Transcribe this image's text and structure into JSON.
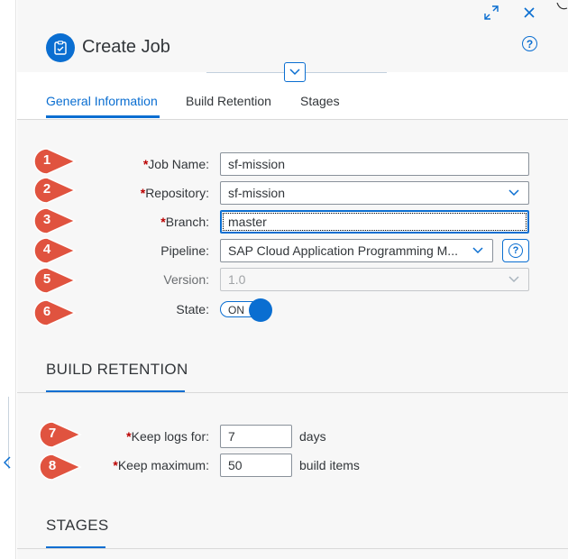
{
  "dialog": {
    "title": "Create Job"
  },
  "tabs": [
    {
      "label": "General Information",
      "active": true
    },
    {
      "label": "Build Retention",
      "active": false
    },
    {
      "label": "Stages",
      "active": false
    }
  ],
  "form": {
    "required_mark": "*",
    "job_name": {
      "label": "Job Name:",
      "value": "sf-mission"
    },
    "repository": {
      "label": "Repository:",
      "value": "sf-mission"
    },
    "branch": {
      "label": "Branch:",
      "value": "master"
    },
    "pipeline": {
      "label": "Pipeline:",
      "value": "SAP Cloud Application Programming M...",
      "help": "?"
    },
    "version": {
      "label": "Version:",
      "value": "1.0"
    },
    "state": {
      "label": "State:",
      "value": "ON"
    }
  },
  "build_retention": {
    "heading": "BUILD RETENTION",
    "keep_logs": {
      "label": "Keep logs for:",
      "value": "7",
      "unit": "days"
    },
    "keep_maximum": {
      "label": "Keep maximum:",
      "value": "50",
      "unit": "build items"
    }
  },
  "stages": {
    "heading": "STAGES"
  },
  "help_glyph": "?",
  "markers": [
    "1",
    "2",
    "3",
    "4",
    "5",
    "6",
    "7",
    "8"
  ],
  "colors": {
    "accent": "#0a6ed1",
    "required": "#bb0000",
    "marker": "#e0533f"
  }
}
